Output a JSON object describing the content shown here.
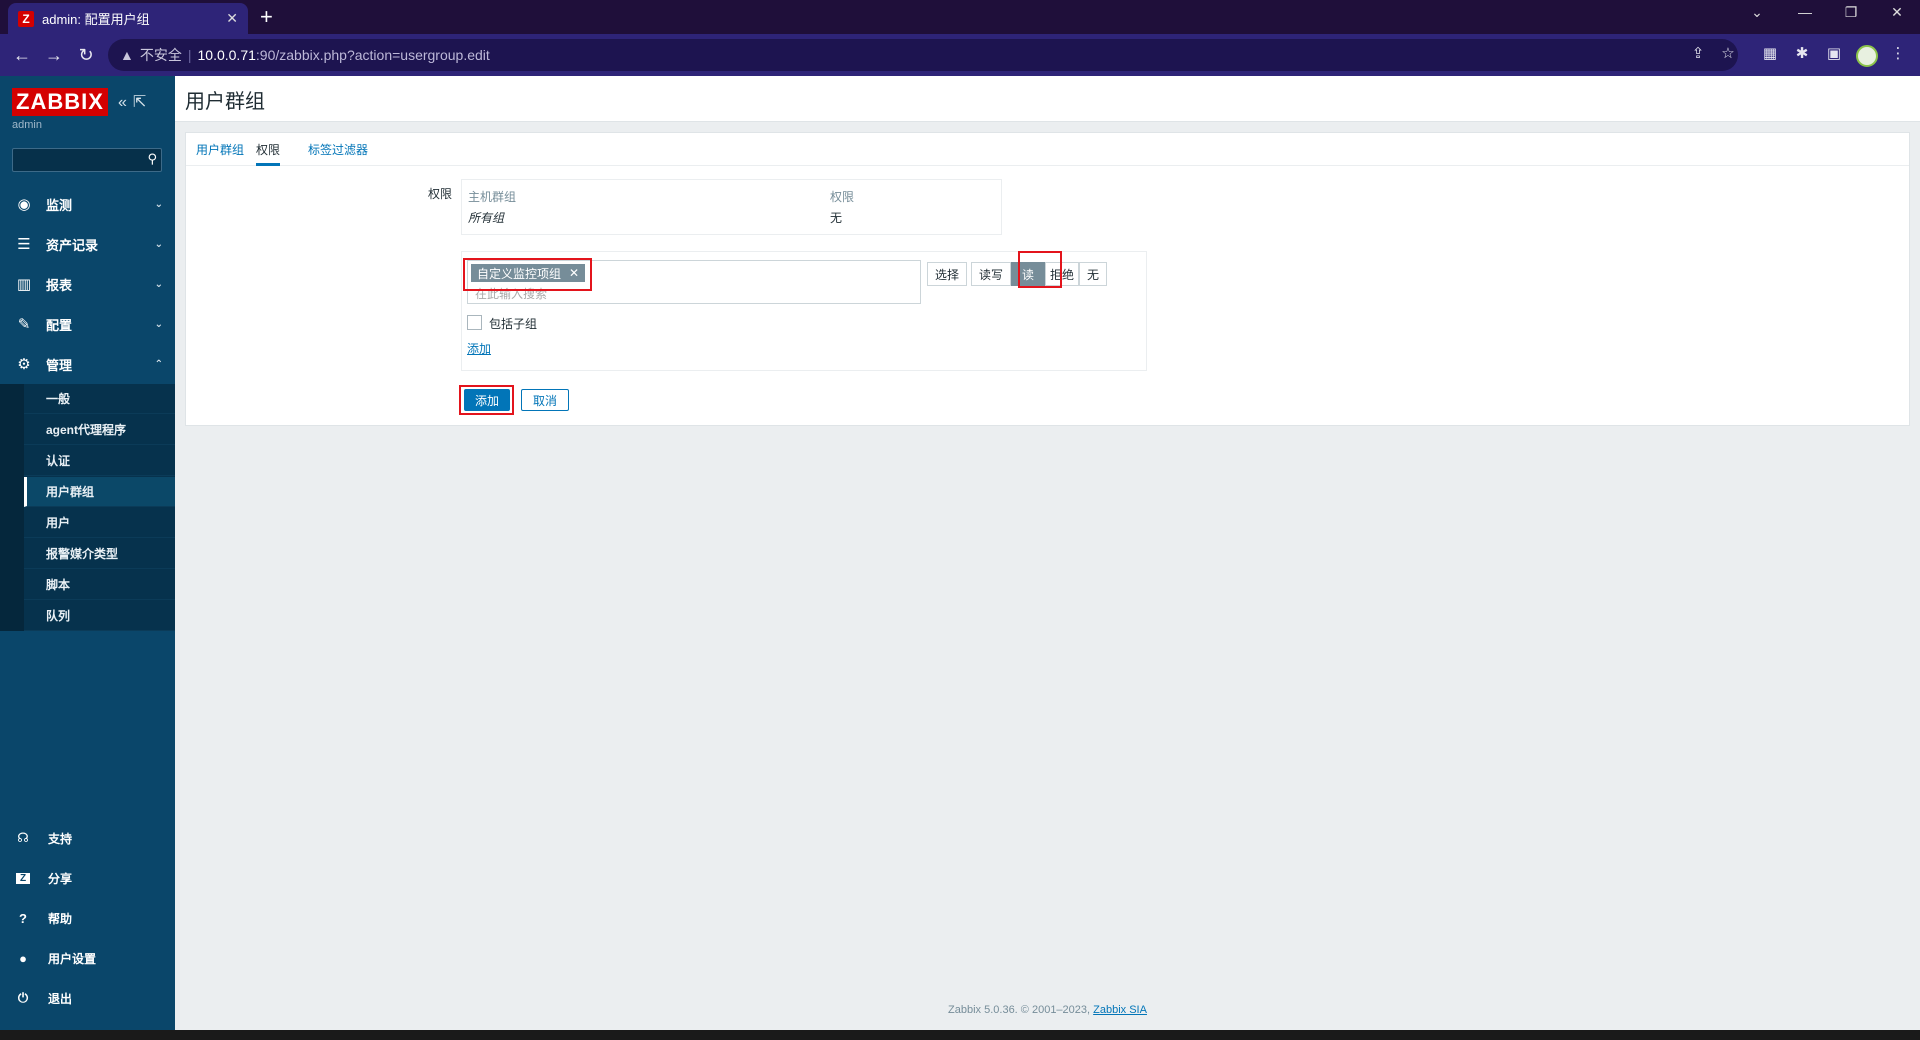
{
  "browser": {
    "tab_title": "admin: 配置用户组",
    "favicon": "Z",
    "security_label": "不安全",
    "url_host": "10.0.0.71",
    "url_path": ":90/zabbix.php?action=usergroup.edit"
  },
  "sidebar": {
    "logo": "ZABBIX",
    "user": "admin",
    "menu": [
      {
        "label": "监测",
        "icon": "eye-icon"
      },
      {
        "label": "资产记录",
        "icon": "list-icon"
      },
      {
        "label": "报表",
        "icon": "bar-chart-icon"
      },
      {
        "label": "配置",
        "icon": "wrench-icon"
      },
      {
        "label": "管理",
        "icon": "gear-icon"
      }
    ],
    "admin_sub": [
      "一般",
      "agent代理程序",
      "认证",
      "用户群组",
      "用户",
      "报警媒介类型",
      "脚本",
      "队列"
    ],
    "bottom": [
      {
        "label": "支持",
        "icon": "headset-icon"
      },
      {
        "label": "分享",
        "icon": "share-icon"
      },
      {
        "label": "帮助",
        "icon": "help-icon"
      },
      {
        "label": "用户设置",
        "icon": "user-icon"
      },
      {
        "label": "退出",
        "icon": "power-icon"
      }
    ]
  },
  "page": {
    "title": "用户群组",
    "tabs": [
      "用户群组",
      "权限",
      "标签过滤器"
    ],
    "active_tab": "权限",
    "permissions_label": "权限",
    "table": {
      "headers": [
        "主机群组",
        "权限"
      ],
      "rows": [
        [
          "所有组",
          "无"
        ]
      ]
    },
    "multiselect": {
      "tag": "自定义监控项组",
      "placeholder": "在此输入搜索"
    },
    "select_button": "选择",
    "permission_options": [
      "读写",
      "读",
      "拒绝",
      "无"
    ],
    "selected_permission": "读",
    "include_subgroups": "包括子组",
    "add_link": "添加",
    "add_button": "添加",
    "cancel_button": "取消"
  },
  "footer": {
    "text": "Zabbix 5.0.36. © 2001–2023,",
    "link": "Zabbix SIA"
  },
  "colors": {
    "sidebar": "#0a466a",
    "accent": "#0275b8",
    "highlight": "#e3141c",
    "logo": "#d40000"
  }
}
